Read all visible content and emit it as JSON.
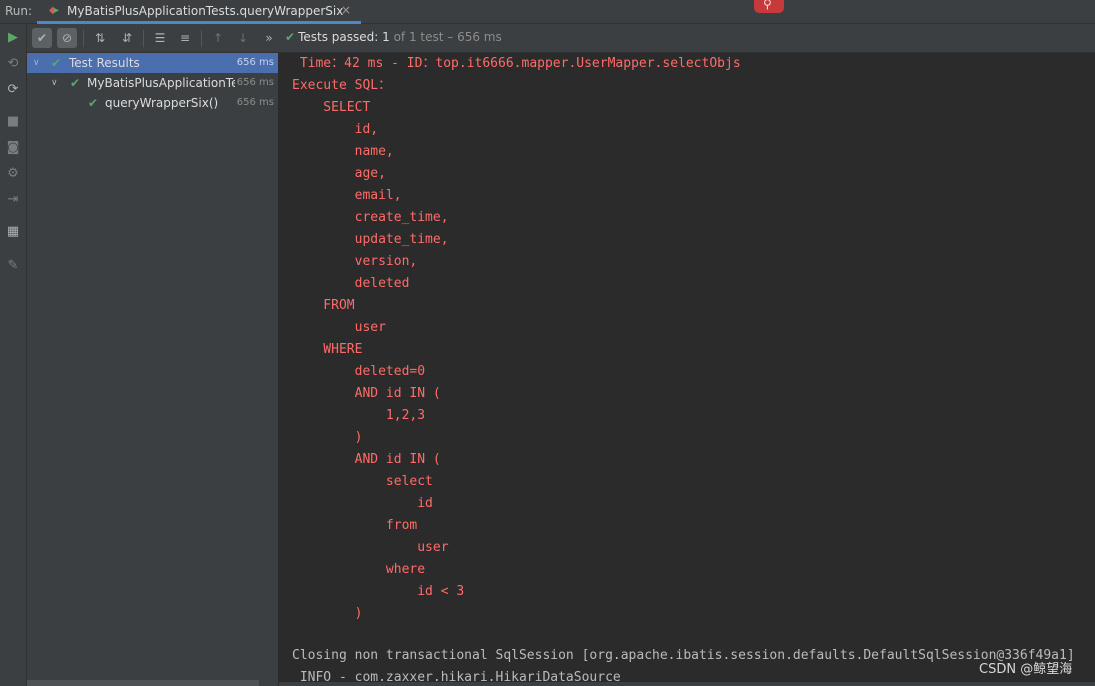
{
  "run_tool": {
    "label": "Run:",
    "tab_title": "MyBatisPlusApplicationTests.queryWrapperSix",
    "close_glyph": "×"
  },
  "toolbar": {
    "status_prefix": "Tests passed:",
    "status_count": "1",
    "status_suffix": "of 1 test – 656 ms",
    "more_glyph": "»"
  },
  "test_tree": [
    {
      "label": "Test Results",
      "time": "656 ms",
      "selected": true
    },
    {
      "label": "MyBatisPlusApplicationTe",
      "time": "656 ms",
      "selected": false
    },
    {
      "label": "queryWrapperSix()",
      "time": "656 ms",
      "selected": false
    }
  ],
  "console": {
    "lines": [
      " Time：42 ms - ID：top.it6666.mapper.UserMapper.selectObjs",
      "Execute SQL：",
      "    SELECT",
      "        id,",
      "        name,",
      "        age,",
      "        email,",
      "        create_time,",
      "        update_time,",
      "        version,",
      "        deleted",
      "    FROM",
      "        user",
      "    WHERE",
      "        deleted=0",
      "        AND id IN (",
      "            1,2,3",
      "        )",
      "        AND id IN (",
      "            select",
      "                id",
      "            from",
      "                user",
      "            where",
      "                id < 3",
      "        )",
      "",
      "Closing non transactional SqlSession [org.apache.ibatis.session.defaults.DefaultSqlSession@336f49a1]",
      " INFO - com.zaxxer.hikari.HikariDataSource"
    ],
    "watermark": "CSDN @鲸望海"
  },
  "colors": {
    "sql_text": "#ff6b68",
    "pass_green": "#59a869",
    "selection": "#4b6eaf"
  }
}
